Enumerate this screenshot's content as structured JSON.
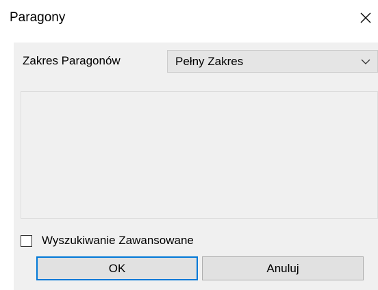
{
  "window": {
    "title": "Paragony",
    "close_icon": "close-icon"
  },
  "form": {
    "range_label": "Zakres Paragonów",
    "range_select": {
      "selected": "Pełny Zakres",
      "icon": "chevron-down-icon"
    },
    "advanced_search_label": "Wyszukiwanie Zawansowane",
    "advanced_search_checked": false
  },
  "buttons": {
    "ok_label": "OK",
    "cancel_label": "Anuluj"
  },
  "colors": {
    "client_background": "#f0f0f0",
    "focus_border": "#0078d7"
  }
}
